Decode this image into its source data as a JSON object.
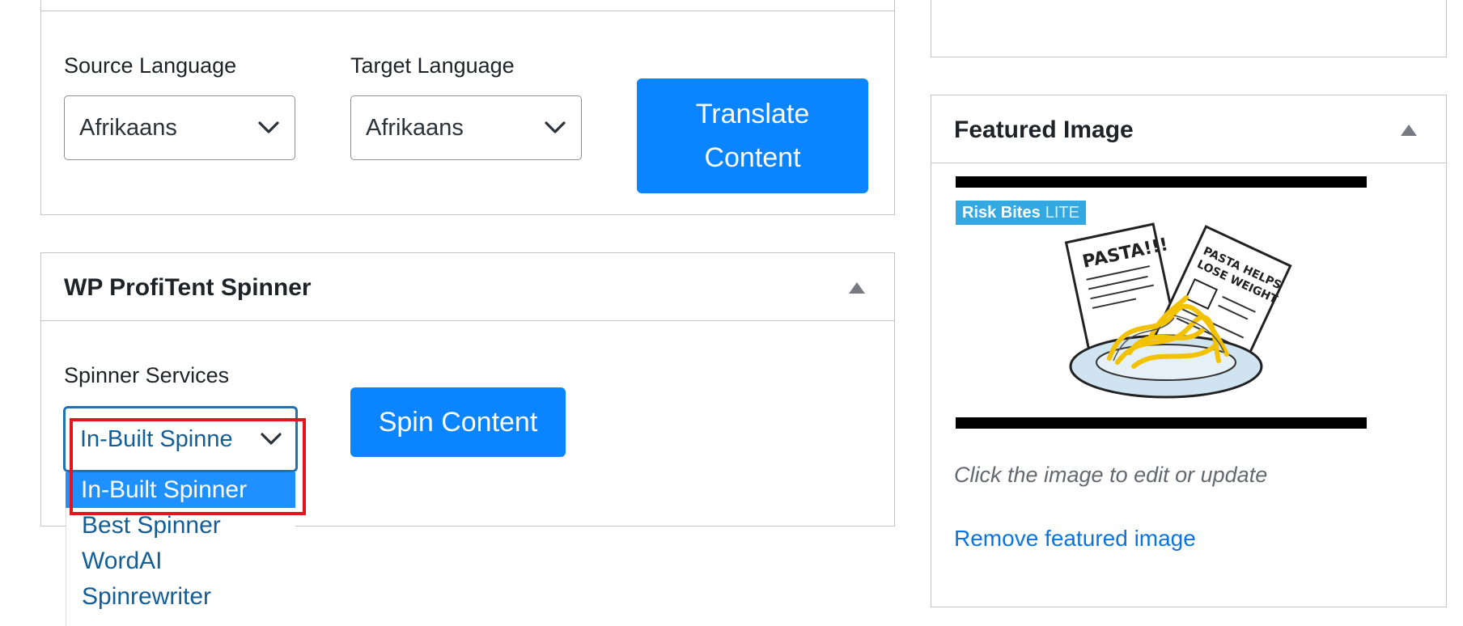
{
  "translate": {
    "source_label": "Source Language",
    "source_value": "Afrikaans",
    "target_label": "Target Language",
    "target_value": "Afrikaans",
    "button_label": "Translate Content"
  },
  "spinner": {
    "title": "WP ProfiTent Spinner",
    "services_label": "Spinner Services",
    "services_value": "In-Built Spinne",
    "button_label": "Spin Content",
    "options": [
      "In-Built Spinner",
      "Best Spinner",
      "WordAI",
      "Spinrewriter"
    ],
    "selected_index": 0
  },
  "featured": {
    "title": "Featured Image",
    "image_logo": "Risk Bites",
    "image_logo_suffix": "LITE",
    "hint": "Click the image to edit or update",
    "remove_link": "Remove featured image"
  },
  "colors": {
    "primary_button": "#0a84ff",
    "selected_option": "#1e90ff",
    "link": "#0a74e0",
    "highlight": "#e8131b"
  }
}
